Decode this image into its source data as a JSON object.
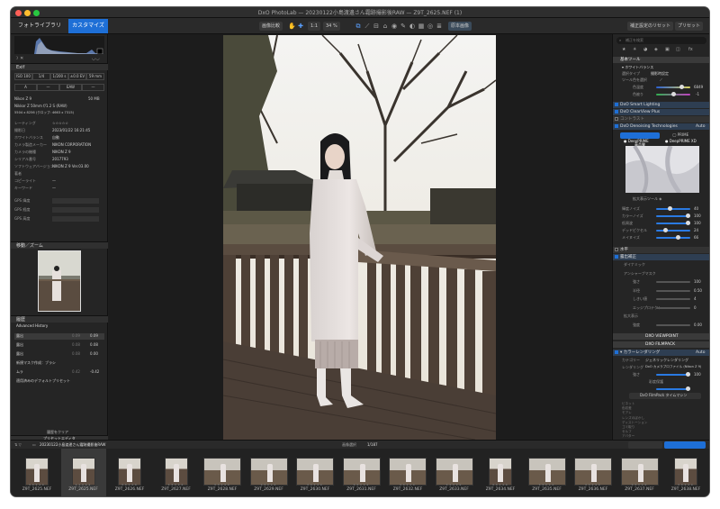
{
  "window": {
    "title": "DxO PhotoLab — 20230122小島渡邊さん霜跡撮影後RAW — Z9T_2625.NEF (1)"
  },
  "toolbar": {
    "tab_library": "フォトライブラリ",
    "tab_customize": "カスタマイズ",
    "compare_btn": "画像比較",
    "zoom_fit": "1:1",
    "zoom_level": "34 %",
    "compare_original": "原本画像",
    "reset_btn": "補正設定のリセット",
    "preset_btn": "プリセット"
  },
  "left": {
    "exif_label": "Exif",
    "exif_values": [
      "ISO 100",
      "1/4",
      "1/200 s",
      "±0.0 EV",
      "59 mm"
    ],
    "exif_values2": [
      "A",
      "—",
      "EAW",
      "—"
    ],
    "camera_line": "Nikon Z 9",
    "camera_size": "50 MB",
    "lens_line": "Nikkor Z 50mm f/1.2 S (RAW)",
    "dims_line": "5504 x 8256 (クロップ: 4663 x 7315)",
    "info_rows": [
      {
        "k": "レーティング",
        "v": "☆☆☆☆☆"
      },
      {
        "k": "撮影日",
        "v": "2023/01/22 16:21:45"
      },
      {
        "k": "ホワイトバランス",
        "v": "自動"
      },
      {
        "k": "カメラ製造メーカー",
        "v": "NIKON CORPORATION"
      },
      {
        "k": "カメラの機種",
        "v": "NIKON Z 9"
      },
      {
        "k": "シリアル番号",
        "v": "2017793"
      },
      {
        "k": "ソフトウェアバージョン",
        "v": "NIKON Z 9 Ver.03.00"
      },
      {
        "k": "著者",
        "v": ""
      },
      {
        "k": "コピーライト",
        "v": "—"
      },
      {
        "k": "キーワード",
        "v": "—"
      }
    ],
    "gps_rows": [
      "GPS 緯度",
      "GPS 経度",
      "GPS 高度"
    ],
    "nav_title": "移動／ズーム",
    "history_title": "履歴",
    "history_sub": "Advanced History",
    "history_items": [
      {
        "label": "露出",
        "v1": "0.09",
        "v2": "0.09"
      },
      {
        "label": "露出",
        "v1": "0.08",
        "v2": "0.08"
      },
      {
        "label": "露出",
        "v1": "0.08",
        "v2": "0.00"
      },
      {
        "label": "新規マスク作成：ブラシ",
        "v1": "",
        "v2": ""
      },
      {
        "label": "ムラ",
        "v1": "0.42",
        "v2": "-0.42"
      },
      {
        "label": "適用済みのデフォルトプリセット",
        "v1": "",
        "v2": ""
      }
    ],
    "clear_history": "履歴をクリア",
    "preset_editor": "プリセットエディタ"
  },
  "right": {
    "search_placeholder": "補正を検索",
    "basic_tools": "基本ツール",
    "wb_label": "ホワイトバランス",
    "wb_mode_label": "選択タイプ",
    "wb_mode": "撮影時設定",
    "eyedrop_label": "ツール色を選択",
    "temp_label": "色温度",
    "temp_val": "6849",
    "tint_label": "色被り",
    "tint_val": "-1",
    "sections": [
      "DxO Smart Lighting",
      "DxO ClearView Plus",
      "コントラスト"
    ],
    "denoise_title": "DxO Denoising Technologies",
    "denoise_auto": "Auto",
    "denoise_hq": "高品質",
    "denoise_prime": "PRIME",
    "denoise_deepprime": "DeepPRIME",
    "denoise_deepprimexd": "DeepPRIME XD",
    "magnify_label": "拡大表示ツール",
    "denoise_sliders": [
      {
        "label": "輝度ノイズ",
        "val": "40"
      },
      {
        "label": "カラーノイズ",
        "val": "100"
      },
      {
        "label": "低周波",
        "val": "100"
      },
      {
        "label": "デッドピクセル",
        "val": "24"
      },
      {
        "label": "メイヌイズ",
        "val": "66"
      }
    ],
    "sec_straighten": "水平",
    "sec_exposure": "露出補正",
    "exp_rows": [
      {
        "label": "ダイナミック",
        "val": ""
      },
      {
        "label": "アンシャープマスク",
        "val": ""
      },
      {
        "label": "強さ",
        "val": "100"
      },
      {
        "label": "半径",
        "val": "0.50"
      },
      {
        "label": "しきい値",
        "val": "4"
      },
      {
        "label": "エッジプロテクト",
        "val": "0"
      },
      {
        "label": "拡大表示",
        "val": ""
      },
      {
        "label": "強度",
        "val": "0.00"
      }
    ],
    "viewpoint": "DXO VIEWPOINT",
    "filmpack": "DXO FILMPACK",
    "color_rendering": "カラーレンダリング",
    "cr_auto": "Auto",
    "category_label": "カテゴリー",
    "category_value": "ジェネリックレンダリング",
    "rendering_label": "レンダリング",
    "rendering_value": "DxO カメラプロファイル (Nikon Z 9)",
    "intensity_label": "強さ",
    "intensity_val": "100",
    "protect_label": "彩度保護",
    "tonecurve_label": "DxO FilmPack タイムマシン",
    "bottom_rows": [
      "ビネット",
      "色収差",
      "モアレ",
      "レンズのぼかし",
      "ディストーション",
      "ゴミ取り",
      "セルフ",
      "アバター"
    ]
  },
  "bottom": {
    "folder": "20230122小島渡邊さん霜跡撮影後RAW",
    "selection_label": "画像選択",
    "count": "1/187",
    "nik_btn": "Nik Collection",
    "export_btn": "エクスポート"
  },
  "thumbs": [
    "Z9T_2625.NEF",
    "Z9T_2625.NEF",
    "Z9T_2626.NEF",
    "Z9T_2627.NEF",
    "Z9T_2628.NEF",
    "Z9T_2629.NEF",
    "Z9T_2630.NEF",
    "Z9T_2631.NEF",
    "Z9T_2632.NEF",
    "Z9T_2633.NEF",
    "Z9T_2634.NEF",
    "Z9T_2635.NEF",
    "Z9T_2636.NEF",
    "Z9T_2637.NEF",
    "Z9T_2638.NEF"
  ],
  "colors": {
    "accent": "#1e6fd6",
    "panel": "#252525",
    "slider_blue": "#2a7ae2"
  }
}
